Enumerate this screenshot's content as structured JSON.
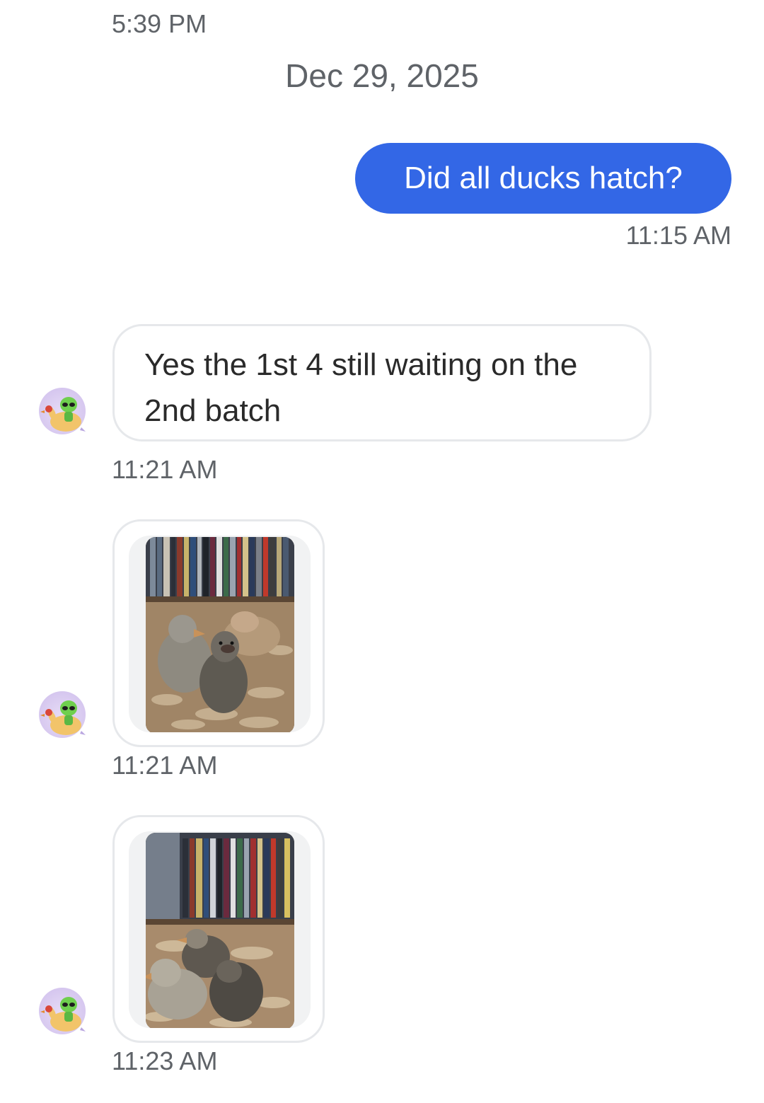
{
  "top_time": "5:39 PM",
  "date_separator": "Dec 29, 2025",
  "messages": [
    {
      "direction": "outgoing",
      "text": "Did all ducks hatch?",
      "time": "11:15 AM"
    },
    {
      "direction": "incoming",
      "text_line1": "Yes the 1st 4 still waiting on the",
      "text_line2": "2nd batch",
      "time": "11:21 AM",
      "avatar_icon": "alien-chicken-avatar-icon"
    },
    {
      "direction": "incoming",
      "type": "image",
      "image": "photo of ducklings in brooder",
      "time": "11:21 AM",
      "avatar_icon": "alien-chicken-avatar-icon"
    },
    {
      "direction": "incoming",
      "type": "image",
      "image": "photo of ducklings in brooder",
      "time": "11:23 AM",
      "avatar_icon": "alien-chicken-avatar-icon"
    }
  ],
  "colors": {
    "outgoing_bubble": "#3367e6",
    "incoming_border": "#e6e8eb",
    "timestamp": "#5f6368"
  }
}
